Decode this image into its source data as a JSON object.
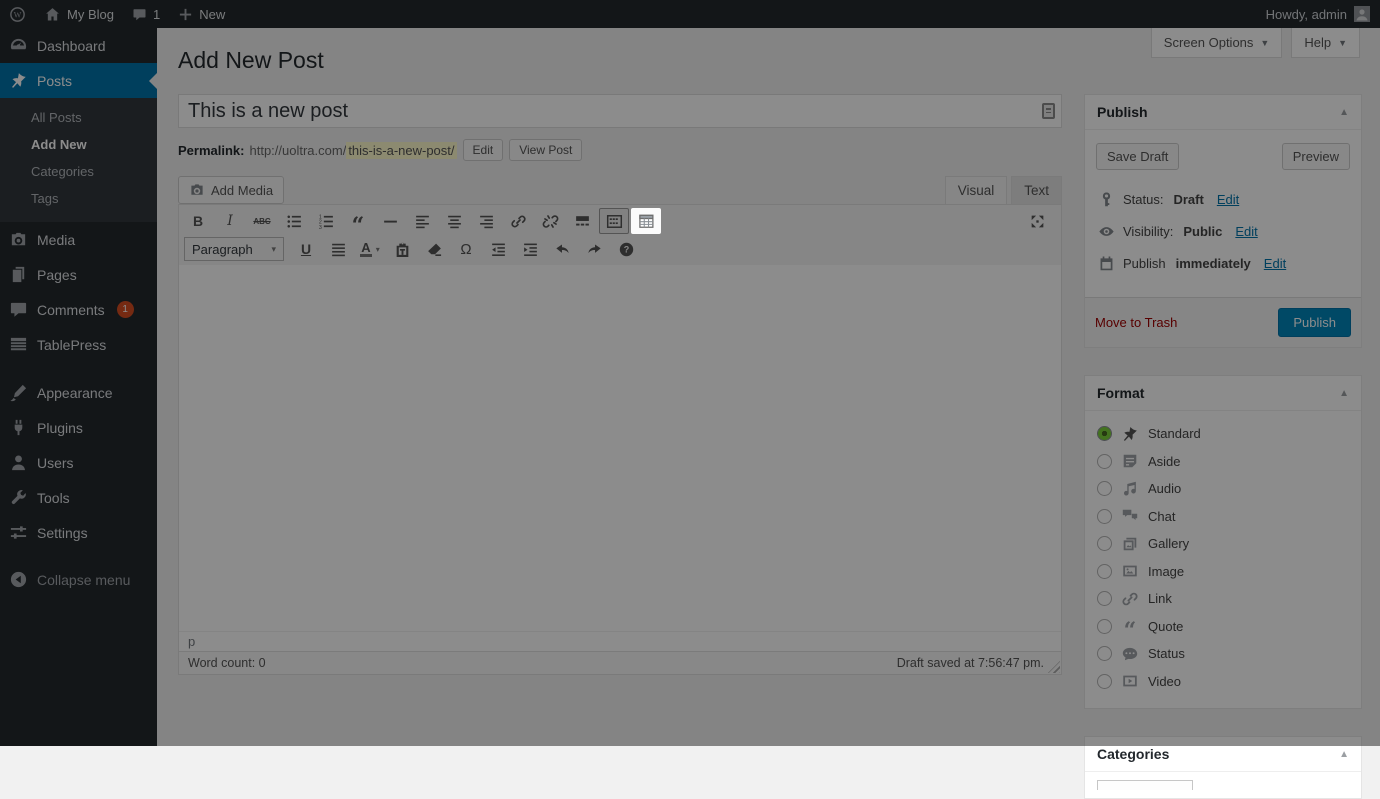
{
  "admin_bar": {
    "site_name": "My Blog",
    "comment_count": "1",
    "new_label": "New",
    "howdy": "Howdy, admin"
  },
  "screen_tabs": {
    "screen_options": "Screen Options",
    "help": "Help"
  },
  "page_title": "Add New Post",
  "sidebar": {
    "items": [
      {
        "id": "dashboard",
        "label": "Dashboard",
        "icon": "dashboard-icon"
      },
      {
        "id": "posts",
        "label": "Posts",
        "icon": "pin-icon",
        "active": true
      },
      {
        "id": "media",
        "label": "Media",
        "icon": "media-icon"
      },
      {
        "id": "pages",
        "label": "Pages",
        "icon": "pages-icon"
      },
      {
        "id": "comments",
        "label": "Comments",
        "icon": "comment-icon",
        "badge": "1"
      },
      {
        "id": "tablepress",
        "label": "TablePress",
        "icon": "tablepress-icon"
      },
      {
        "id": "appearance",
        "label": "Appearance",
        "icon": "appearance-icon",
        "section_break": true
      },
      {
        "id": "plugins",
        "label": "Plugins",
        "icon": "plugins-icon"
      },
      {
        "id": "users",
        "label": "Users",
        "icon": "users-icon"
      },
      {
        "id": "tools",
        "label": "Tools",
        "icon": "tools-icon"
      },
      {
        "id": "settings",
        "label": "Settings",
        "icon": "settings-icon"
      }
    ],
    "posts_submenu": [
      {
        "label": "All Posts"
      },
      {
        "label": "Add New",
        "current": true
      },
      {
        "label": "Categories"
      },
      {
        "label": "Tags"
      }
    ],
    "collapse_label": "Collapse menu"
  },
  "title_field": {
    "value": "This is a new post"
  },
  "permalink": {
    "label": "Permalink:",
    "base": "http://uoltra.com/",
    "slug": "this-is-a-new-post/",
    "edit_button": "Edit",
    "view_button": "View Post"
  },
  "media_buttons": {
    "add_media": "Add Media"
  },
  "editor": {
    "tabs": {
      "visual": "Visual",
      "text": "Text"
    },
    "paragraph_dropdown": "Paragraph",
    "toolbar_row1": [
      {
        "name": "bold",
        "icon": "bold-icon"
      },
      {
        "name": "italic",
        "icon": "italic-icon"
      },
      {
        "name": "strikethrough",
        "icon": "strikethrough-icon"
      },
      {
        "name": "bulleted-list",
        "icon": "bulleted-list-icon"
      },
      {
        "name": "numbered-list",
        "icon": "numbered-list-icon"
      },
      {
        "name": "blockquote",
        "icon": "blockquote-icon"
      },
      {
        "name": "horizontal-rule",
        "icon": "horizontal-rule-icon"
      },
      {
        "name": "align-left",
        "icon": "align-left-icon"
      },
      {
        "name": "align-center",
        "icon": "align-center-icon"
      },
      {
        "name": "align-right",
        "icon": "align-right-icon"
      },
      {
        "name": "insert-link",
        "icon": "link-icon"
      },
      {
        "name": "remove-link",
        "icon": "unlink-icon"
      },
      {
        "name": "insert-more-tag",
        "icon": "more-tag-icon"
      },
      {
        "name": "toolbar-toggle",
        "icon": "toolbar-toggle-icon",
        "active": true
      },
      {
        "name": "tablepress-insert",
        "icon": "tablepress-table-icon",
        "highlighted": true
      }
    ],
    "toolbar_row2": [
      {
        "name": "underline",
        "icon": "underline-icon"
      },
      {
        "name": "justify",
        "icon": "align-justify-icon"
      },
      {
        "name": "text-color",
        "icon": "text-color-icon"
      },
      {
        "name": "paste-as-text",
        "icon": "paste-as-text-icon"
      },
      {
        "name": "clear-formatting",
        "icon": "clear-formatting-icon"
      },
      {
        "name": "special-character",
        "icon": "special-character-icon"
      },
      {
        "name": "decrease-indent",
        "icon": "outdent-icon"
      },
      {
        "name": "increase-indent",
        "icon": "indent-icon"
      },
      {
        "name": "undo",
        "icon": "undo-icon"
      },
      {
        "name": "redo",
        "icon": "redo-icon"
      },
      {
        "name": "help",
        "icon": "help-icon"
      }
    ],
    "dfw_icon": "distraction-free-icon",
    "path": "p",
    "word_count_label": "Word count:",
    "word_count_value": "0",
    "autosave_message": "Draft saved at 7:56:47 pm."
  },
  "publish_box": {
    "title": "Publish",
    "save_draft": "Save Draft",
    "preview": "Preview",
    "rows": [
      {
        "icon": "key-icon",
        "label": "Status:",
        "value": "Draft",
        "action": "Edit"
      },
      {
        "icon": "eye-icon",
        "label": "Visibility:",
        "value": "Public",
        "action": "Edit"
      },
      {
        "icon": "calendar-icon",
        "label": "Publish",
        "value": "immediately",
        "action": "Edit"
      }
    ],
    "move_to_trash": "Move to Trash",
    "publish_button": "Publish"
  },
  "format_box": {
    "title": "Format",
    "options": [
      {
        "label": "Standard",
        "icon": "pin-icon",
        "selected": true
      },
      {
        "label": "Aside",
        "icon": "aside-icon"
      },
      {
        "label": "Audio",
        "icon": "audio-icon"
      },
      {
        "label": "Chat",
        "icon": "chat-icon"
      },
      {
        "label": "Gallery",
        "icon": "gallery-icon"
      },
      {
        "label": "Image",
        "icon": "image-icon"
      },
      {
        "label": "Link",
        "icon": "link-icon"
      },
      {
        "label": "Quote",
        "icon": "quote-icon"
      },
      {
        "label": "Status",
        "icon": "status-icon"
      },
      {
        "label": "Video",
        "icon": "video-icon"
      }
    ]
  },
  "categories_box": {
    "title": "Categories"
  },
  "colors": {
    "admin_bar_bg": "#23282d",
    "menu_active_blue": "#0073aa",
    "primary_button_blue": "#0085ba",
    "comment_badge_red": "#d54e21",
    "trash_red": "#a00000",
    "slug_highlight_yellow": "#fffbcc",
    "radio_selected_green": "#7ad03a"
  }
}
